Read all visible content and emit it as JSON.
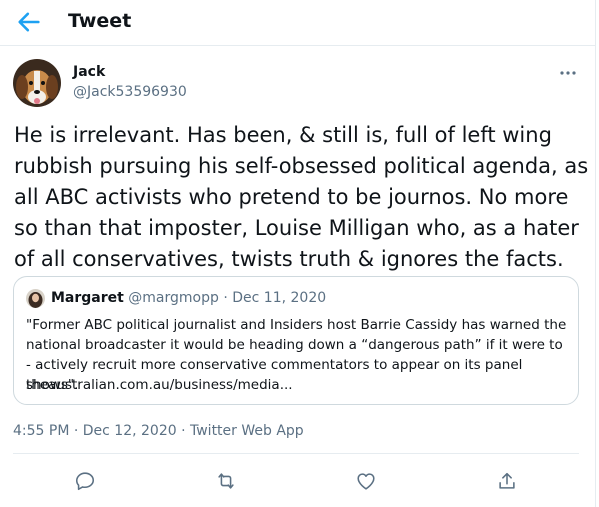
{
  "header": {
    "title": "Tweet",
    "back_icon": "arrow-left-icon"
  },
  "tweet": {
    "author_name": "Jack",
    "author_handle": "@Jack53596930",
    "more_icon": "more-horizontal-icon",
    "text": "He is irrelevant. Has been, & still is, full of  left wing rubbish pursuing his self-obsessed political agenda, as all ABC activists who pretend to be journos. No more so than that imposter, Louise Milligan who, as a hater of all conservatives, twists truth & ignores the facts.",
    "timestamp": "4:55 PM · Dec 12, 2020 · Twitter Web App"
  },
  "quoted": {
    "name": "Margaret",
    "handle": "@margmopp",
    "separator": " · ",
    "date": "Dec 11, 2020",
    "text": "\"Former ABC political journalist and Insiders host Barrie Cassidy has warned the national broadcaster it would be heading down a “dangerous path” if it were to - actively recruit more conservative commentators to appear on its panel shows\".",
    "link": "theaustralian.com.au/business/media..."
  },
  "actions": [
    "reply-icon",
    "retweet-icon",
    "like-icon",
    "share-icon"
  ],
  "colors": {
    "accent": "#1da1f2",
    "secondary_text": "#5b7083",
    "border": "#e6ecf0"
  }
}
